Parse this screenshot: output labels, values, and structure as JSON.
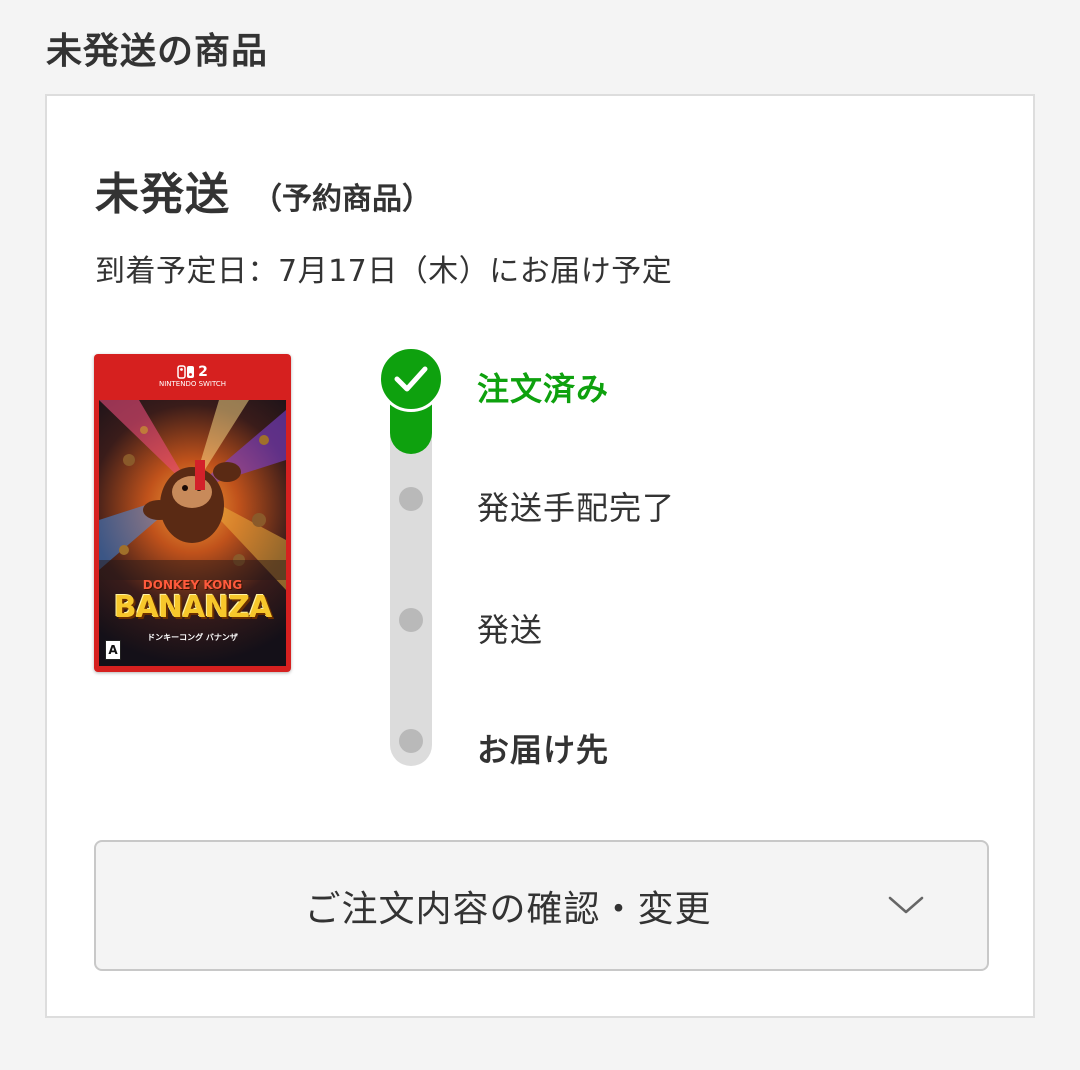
{
  "section": {
    "title": "未発送の商品"
  },
  "order": {
    "status_title": "未発送",
    "status_sub": "（予約商品）",
    "delivery_date": "到着予定日：7月17日（木）にお届け予定"
  },
  "product": {
    "image_icon": "game-box-art",
    "platform_label": "2",
    "platform_sub": "NINTENDO SWITCH",
    "title_line1": "DONKEY KONG",
    "title_line2": "BANANZA",
    "title_kana": "ドンキーコング バナンザ",
    "rating": "A"
  },
  "progress": {
    "steps": [
      {
        "label": "注文済み",
        "state": "done"
      },
      {
        "label": "発送手配完了",
        "state": "pending"
      },
      {
        "label": "発送",
        "state": "pending"
      },
      {
        "label": "お届け先",
        "state": "pending"
      }
    ],
    "colors": {
      "done": "#0ea10e",
      "pending": "#b9b9b9",
      "track": "#dcdcdc"
    }
  },
  "actions": {
    "confirm_label": "ご注文内容の確認・変更",
    "confirm_icon": "chevron-down-icon"
  }
}
